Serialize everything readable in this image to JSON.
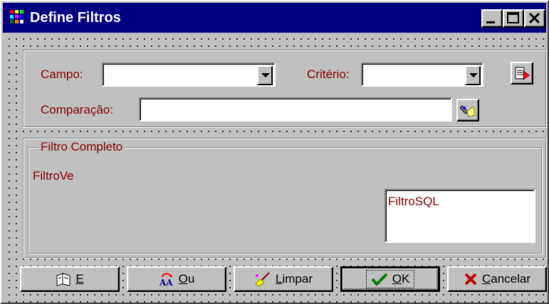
{
  "window": {
    "title": "Define Filtros",
    "app_icon": "app-icon",
    "controls": [
      "minimize-icon",
      "maximize-icon",
      "close-icon"
    ]
  },
  "top_panel": {
    "campo": {
      "label": "Campo:",
      "value": ""
    },
    "criterio": {
      "label": "Critério:",
      "value": ""
    },
    "comparacao": {
      "label": "Comparação:",
      "value": ""
    },
    "insert_icon": "paste-insert-icon",
    "lookup_icon": "flashlight-icon"
  },
  "filter_group": {
    "title": "Filtro Completo",
    "filtro_ve": "FiltroVe",
    "filtro_sql": "FiltroSQL"
  },
  "buttons": [
    {
      "id": "e",
      "mnemonic": "E",
      "rest": "",
      "icon": "and-book-icon"
    },
    {
      "id": "ou",
      "mnemonic": "O",
      "rest": "u",
      "icon": "or-aa-icon"
    },
    {
      "id": "limpar",
      "mnemonic": "L",
      "rest": "impar",
      "icon": "broom-icon"
    },
    {
      "id": "ok",
      "mnemonic": "O",
      "rest": "K",
      "icon": "checkmark-icon"
    },
    {
      "id": "cancelar",
      "mnemonic": "C",
      "rest": "ancelar",
      "icon": "cross-icon"
    }
  ],
  "colors": {
    "titlebar": "#000080",
    "label_text": "#800000",
    "face": "#c0c0c0"
  }
}
